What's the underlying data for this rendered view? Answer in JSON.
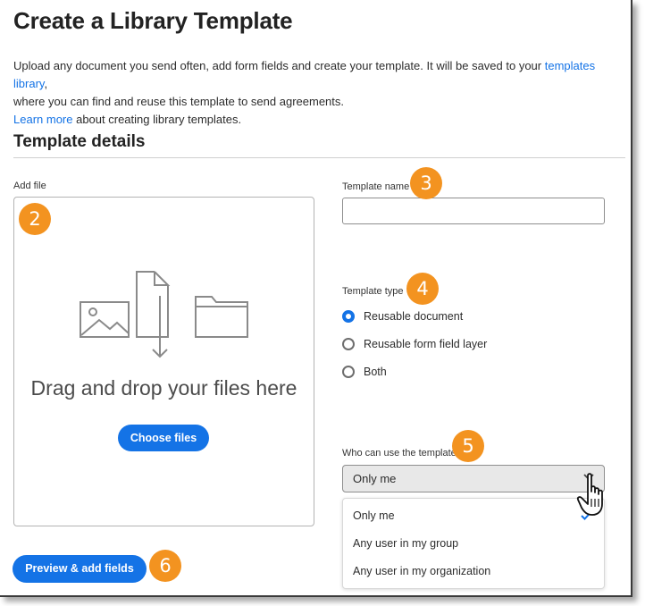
{
  "page": {
    "title": "Create a Library Template",
    "intro_part1": "Upload any document you send often, add form fields and create your template. It will be saved to your ",
    "intro_link": "templates library",
    "intro_part2": ",",
    "intro_line2": "where you can find and reuse this template to send agreements.",
    "learn_more_link": "Learn more",
    "learn_more_rest": " about creating library templates."
  },
  "section": {
    "title": "Template details"
  },
  "add_file": {
    "label": "Add file",
    "drop_text": "Drag and drop your files here",
    "choose_button": "Choose files"
  },
  "template_name": {
    "label": "Template name",
    "value": "",
    "placeholder": ""
  },
  "template_type": {
    "label": "Template type",
    "options": [
      "Reusable document",
      "Reusable form field layer",
      "Both"
    ],
    "selected": "Reusable document"
  },
  "who_can_use": {
    "label": "Who can use the template",
    "selected_value": "Only me",
    "options": [
      "Only me",
      "Any user in my group",
      "Any user in my organization"
    ]
  },
  "preview_button": "Preview & add fields",
  "callouts": [
    "2",
    "3",
    "4",
    "5",
    "6"
  ],
  "colors": {
    "accent": "#1473e6",
    "callout": "#f39320",
    "text": "#2c2c2c"
  },
  "icons": [
    "image-icon",
    "document-download-icon",
    "folder-icon",
    "chevron-down-icon",
    "checkmark-icon",
    "hand-pointer-cursor-icon"
  ]
}
